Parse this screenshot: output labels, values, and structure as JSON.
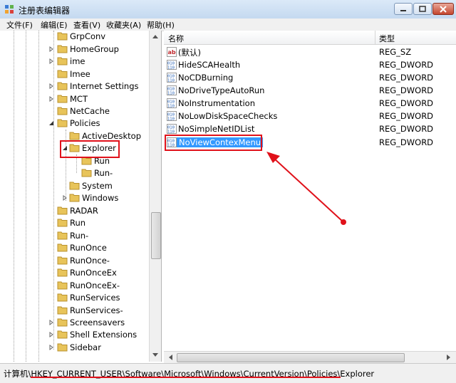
{
  "window": {
    "title": "注册表编辑器"
  },
  "menu": [
    {
      "label": "文件(F)"
    },
    {
      "label": "编辑(E)"
    },
    {
      "label": "查看(V)"
    },
    {
      "label": "收藏夹(A)"
    },
    {
      "label": "帮助(H)"
    }
  ],
  "tree": {
    "items": [
      {
        "label": "GrpConv"
      },
      {
        "label": "HomeGroup"
      },
      {
        "label": "ime"
      },
      {
        "label": "Imee"
      },
      {
        "label": "Internet Settings"
      },
      {
        "label": "MCT"
      },
      {
        "label": "NetCache"
      },
      {
        "label": "Policies"
      },
      {
        "label": "ActiveDesktop"
      },
      {
        "label": "Explorer"
      },
      {
        "label": "Run"
      },
      {
        "label": "Run-"
      },
      {
        "label": "System"
      },
      {
        "label": "Windows"
      },
      {
        "label": "RADAR"
      },
      {
        "label": "Run"
      },
      {
        "label": "Run-"
      },
      {
        "label": "RunOnce"
      },
      {
        "label": "RunOnce-"
      },
      {
        "label": "RunOnceEx"
      },
      {
        "label": "RunOnceEx-"
      },
      {
        "label": "RunServices"
      },
      {
        "label": "RunServices-"
      },
      {
        "label": "Screensavers"
      },
      {
        "label": "Shell Extensions"
      },
      {
        "label": "Sidebar"
      }
    ]
  },
  "list": {
    "columns": {
      "name": "名称",
      "type": "类型"
    },
    "rows": [
      {
        "name": "(默认)",
        "type": "REG_SZ",
        "icon": "string-value-icon"
      },
      {
        "name": "HideSCAHealth",
        "type": "REG_DWORD",
        "icon": "binary-value-icon"
      },
      {
        "name": "NoCDBurning",
        "type": "REG_DWORD",
        "icon": "binary-value-icon"
      },
      {
        "name": "NoDriveTypeAutoRun",
        "type": "REG_DWORD",
        "icon": "binary-value-icon"
      },
      {
        "name": "NoInstrumentation",
        "type": "REG_DWORD",
        "icon": "binary-value-icon"
      },
      {
        "name": "NoLowDiskSpaceChecks",
        "type": "REG_DWORD",
        "icon": "binary-value-icon"
      },
      {
        "name": "NoSimpleNetIDList",
        "type": "REG_DWORD",
        "icon": "binary-value-icon"
      },
      {
        "name": "NoViewContexMenu",
        "type": "REG_DWORD",
        "icon": "binary-value-icon"
      }
    ]
  },
  "status": {
    "path": "计算机\\HKEY_CURRENT_USER\\Software\\Microsoft\\Windows\\CurrentVersion\\Policies\\Explorer"
  },
  "colors": {
    "selection": "#3399ff",
    "annotation": "#e0111a",
    "folder": "#e8c45a"
  }
}
